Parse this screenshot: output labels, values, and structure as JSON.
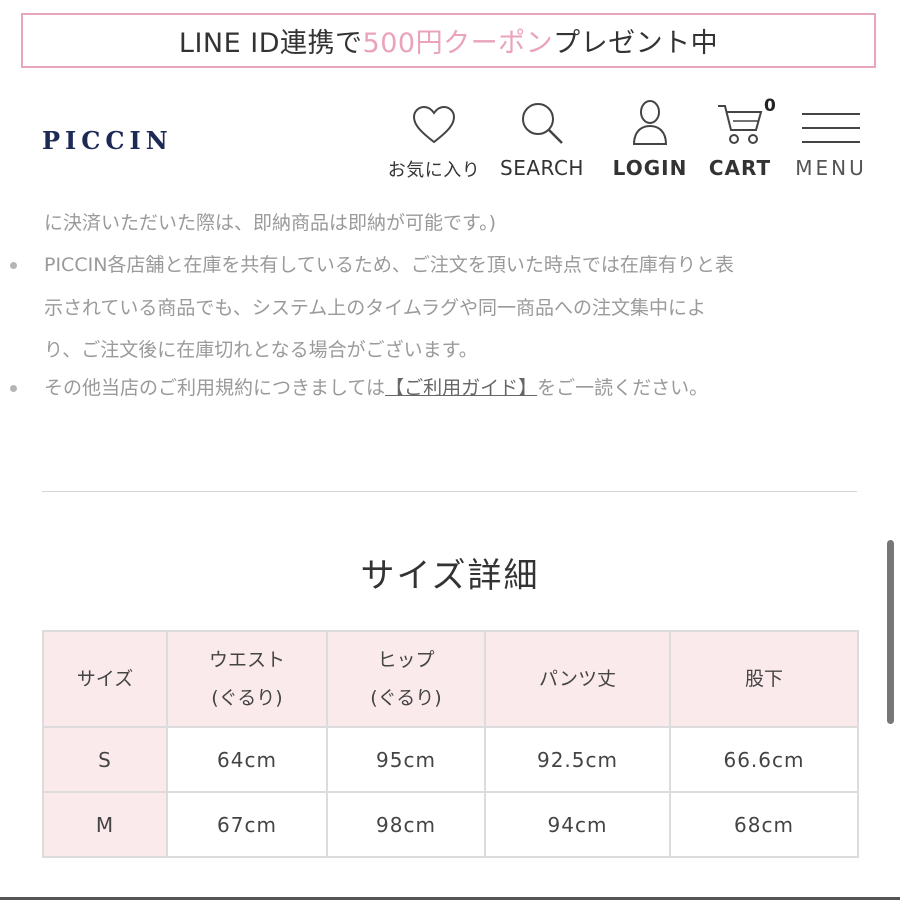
{
  "banner": {
    "prefix": "LINE ID連携で",
    "highlight": "500円クーポン",
    "suffix": "プレゼント中"
  },
  "header": {
    "logo": "PICCIN",
    "nav": {
      "favorites": "お気に入り",
      "search": "SEARCH",
      "login": "LOGIN",
      "cart": "CART",
      "cart_count": "0",
      "menu": "MENU"
    }
  },
  "notes": {
    "line1": "に決済いただいた際は、即納商品は即納が可能です。)",
    "line2": "PICCIN各店舗と在庫を共有しているため、ご注文を頂いた時点では在庫有りと表",
    "line3": "示されている商品でも、システム上のタイムラグや同一商品への注文集中によ",
    "line4": "り、ご注文後に在庫切れとなる場合がございます。",
    "line5_prefix": "その他当店のご利用規約につきましては",
    "line5_link": "【ご利用ガイド】",
    "line5_suffix": "をご一読ください。"
  },
  "size_section": {
    "title": "サイズ詳細",
    "headers": [
      {
        "line1": "サイズ",
        "line2": ""
      },
      {
        "line1": "ウエスト",
        "line2": "(ぐるり)"
      },
      {
        "line1": "ヒップ",
        "line2": "(ぐるり)"
      },
      {
        "line1": "パンツ丈",
        "line2": ""
      },
      {
        "line1": "股下",
        "line2": ""
      }
    ],
    "rows": [
      [
        "S",
        "64cm",
        "95cm",
        "92.5cm",
        "66.6cm"
      ],
      [
        "M",
        "67cm",
        "98cm",
        "94cm",
        "68cm"
      ]
    ]
  },
  "colors": {
    "banner_border": "#e7a6bd",
    "banner_highlight": "#eaa3bb",
    "logo": "#1d2a55",
    "table_header_bg": "#fbeaec"
  },
  "icons": [
    "heart-icon",
    "search-icon",
    "user-icon",
    "cart-icon",
    "hamburger-menu-icon"
  ]
}
